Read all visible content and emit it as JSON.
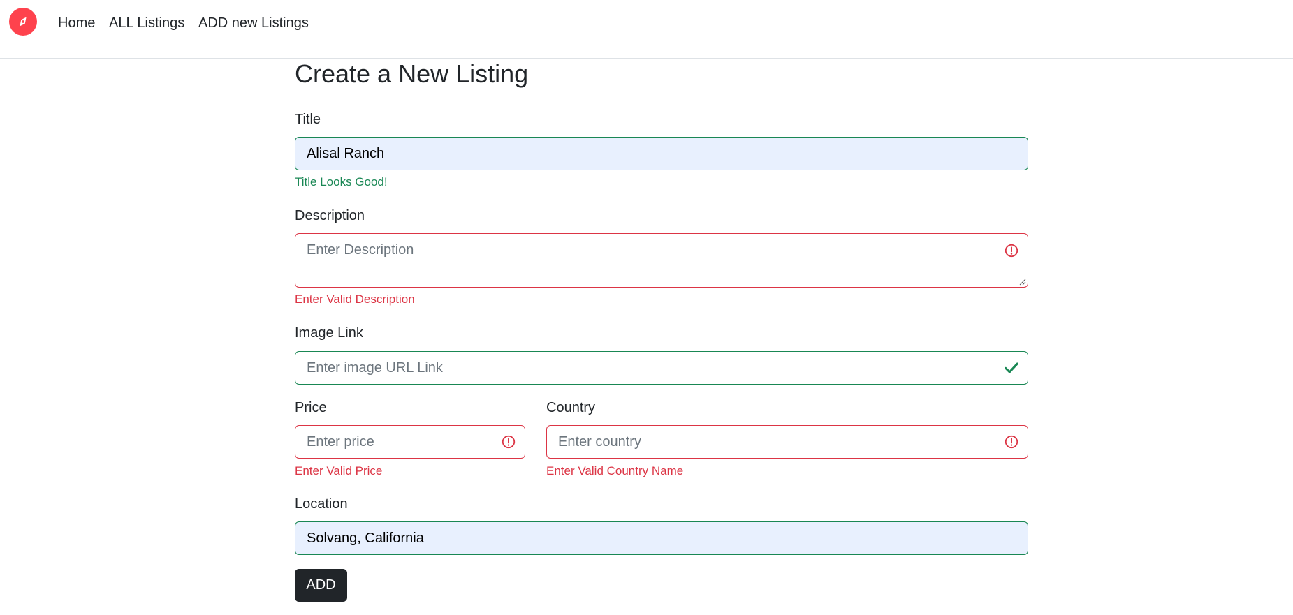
{
  "nav": {
    "links": [
      "Home",
      "ALL Listings",
      "ADD new Listings"
    ]
  },
  "form": {
    "heading": "Create a New Listing",
    "title": {
      "label": "Title",
      "value": "Alisal Ranch",
      "feedback": "Title Looks Good!"
    },
    "description": {
      "label": "Description",
      "placeholder": "Enter Description",
      "feedback": "Enter Valid Description"
    },
    "image": {
      "label": "Image Link",
      "placeholder": "Enter image URL Link"
    },
    "price": {
      "label": "Price",
      "placeholder": "Enter price",
      "feedback": "Enter Valid Price"
    },
    "country": {
      "label": "Country",
      "placeholder": "Enter country",
      "feedback": "Enter Valid Country Name"
    },
    "location": {
      "label": "Location",
      "value": "Solvang, California"
    },
    "submit_label": "ADD"
  },
  "colors": {
    "brand": "#fe424d",
    "valid": "#198754",
    "invalid": "#dc3545",
    "autofill_bg": "#e8f0fe",
    "button_bg": "#212529"
  },
  "icons": {
    "brand": "compass-icon",
    "invalid": "exclamation-circle-icon",
    "valid": "check-icon"
  }
}
